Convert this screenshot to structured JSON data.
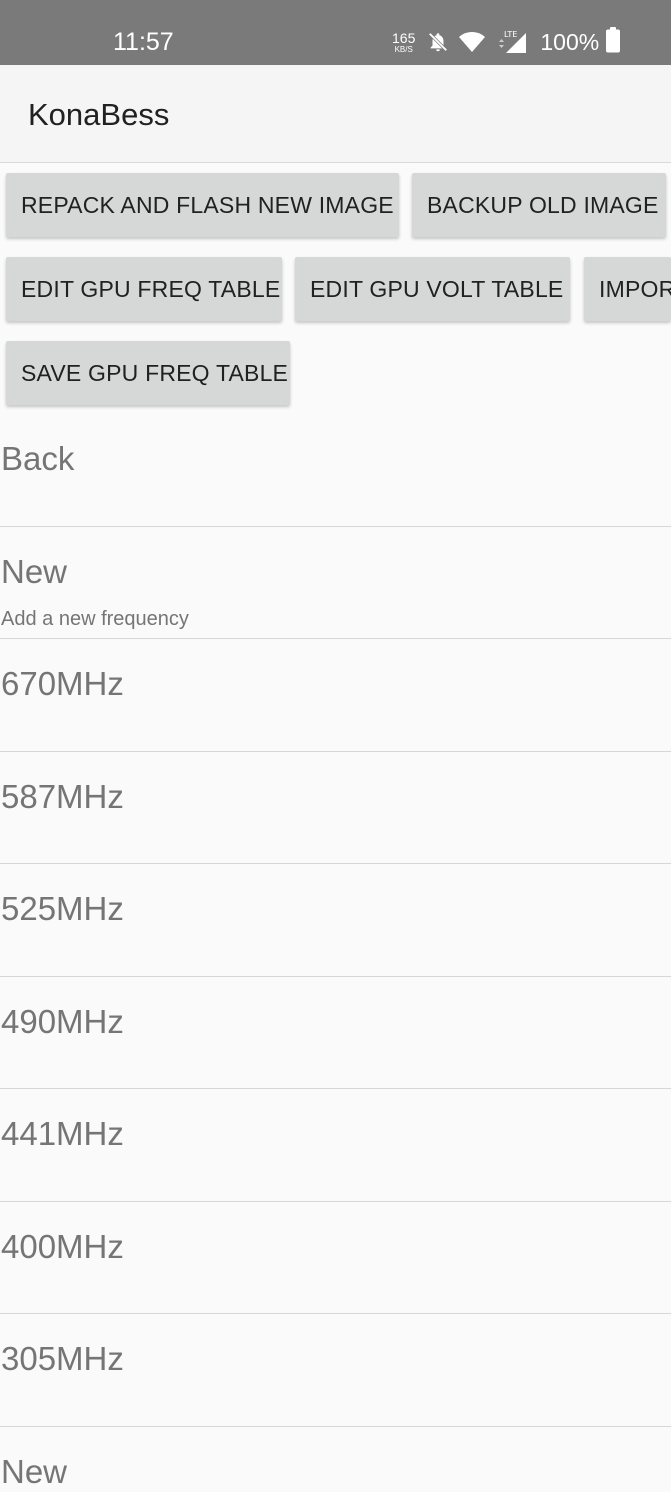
{
  "status_bar": {
    "time": "11:57",
    "net_speed": "165",
    "net_speed_unit": "KB/S",
    "battery": "100%",
    "icons": [
      "bell-off-icon",
      "wifi-icon",
      "lte-signal-icon",
      "battery-icon"
    ],
    "network_type": "LTE"
  },
  "app": {
    "title": "KonaBess"
  },
  "buttons": {
    "repack": "REPACK AND FLASH NEW IMAGE",
    "backup": "BACKUP OLD IMAGE",
    "edit_freq": "EDIT GPU FREQ TABLE",
    "edit_volt": "EDIT GPU VOLT TABLE",
    "import": "IMPOR",
    "save_freq": "SAVE GPU FREQ TABLE"
  },
  "list": {
    "items": [
      {
        "title": "Back"
      },
      {
        "title": "New",
        "subtitle": "Add a new frequency"
      },
      {
        "title": "670MHz"
      },
      {
        "title": "587MHz"
      },
      {
        "title": "525MHz"
      },
      {
        "title": "490MHz"
      },
      {
        "title": "441MHz"
      },
      {
        "title": "400MHz"
      },
      {
        "title": "305MHz"
      },
      {
        "title": "New"
      }
    ]
  },
  "colors": {
    "status_bar_bg": "#7a7a7a",
    "app_bar_bg": "#f5f5f5",
    "button_bg": "#d6d7d7",
    "list_text": "#757575"
  }
}
